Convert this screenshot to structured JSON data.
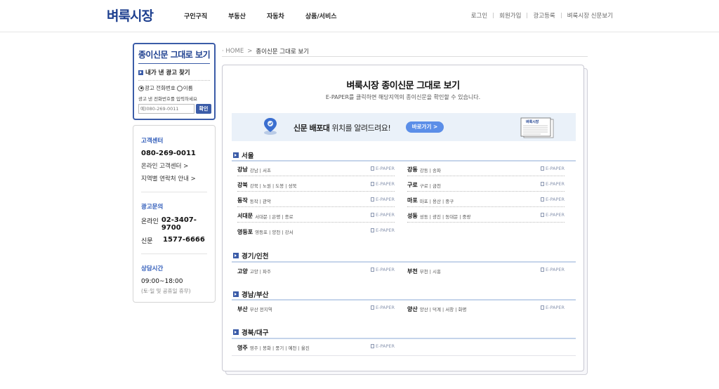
{
  "header": {
    "logo": "벼룩시장",
    "nav": [
      "구인구직",
      "부동산",
      "자동차",
      "상품/서비스"
    ],
    "util": [
      "로그인",
      "회원가입",
      "광고등록",
      "벼룩시장 신문보기"
    ]
  },
  "left": {
    "title": "종이신문 그대로 보기",
    "find_title": "내가 낸 광고 찾기",
    "radio": [
      "광고 전화번호",
      "이름"
    ],
    "hint": "광고 낸 전화번호를 입력하세요",
    "placeholder": "예)080-269-0011",
    "search_button": "확인",
    "cs_title": "고객센터",
    "cs_phone": "080-269-0011",
    "cs_links": [
      "온라인 고객센터 >",
      "지역별 연락처 안내 >"
    ],
    "ad_title": "광고문의",
    "ad_online_label": "온라인",
    "ad_online_val": "02-3407-9700",
    "ad_paper_label": "신문",
    "ad_paper_val": "1577-6666",
    "hours_title": "상담시간",
    "hours": "09:00~18:00",
    "hours_note": "(토·일 및 공휴일 휴무)"
  },
  "breadcrumb": {
    "home": "HOME",
    "sep": ">",
    "current": "종이신문 그대로 보기"
  },
  "main": {
    "title": "벼룩시장 종이신문 그대로 보기",
    "subtitle": "E-PAPER를 클릭하면 해당지역의 종이신문을 확인할 수 있습니다.",
    "banner_bold": "신문 배포대",
    "banner_rest": " 위치를 알려드려요!",
    "banner_button": "바로가기 >",
    "paper_label": "벼룩시장",
    "epaper": "E-PAPER",
    "regions": [
      {
        "name": "서울",
        "rows": [
          {
            "nm": "강남",
            "ds": "강남 | 서초"
          },
          {
            "nm": "강동",
            "ds": "강동 | 송파"
          },
          {
            "nm": "강북",
            "ds": "강북 | 노원 | 도봉 | 성북"
          },
          {
            "nm": "구로",
            "ds": "구로 | 금천"
          },
          {
            "nm": "동작",
            "ds": "동작 | 관악"
          },
          {
            "nm": "마포",
            "ds": "마포 | 용산 | 중구"
          },
          {
            "nm": "서대문",
            "ds": "서대문 | 은평 | 종로"
          },
          {
            "nm": "성동",
            "ds": "성동 | 광진 | 동대문 | 중랑"
          },
          {
            "nm": "영등포",
            "ds": "영등포 | 양천 | 강서"
          }
        ]
      },
      {
        "name": "경기/인천",
        "rows": [
          {
            "nm": "고양",
            "ds": "고양 | 파주"
          },
          {
            "nm": "부천",
            "ds": "부천 | 시흥"
          }
        ]
      },
      {
        "name": "경남/부산",
        "rows": [
          {
            "nm": "부산",
            "ds": "부산 전지역"
          },
          {
            "nm": "양산",
            "ds": "양산 | 덕계 | 서창 | 화명"
          }
        ]
      },
      {
        "name": "경북/대구",
        "rows": [
          {
            "nm": "영주",
            "ds": "영주 | 봉화 | 풍기 | 예천 | 울진"
          }
        ]
      }
    ]
  }
}
